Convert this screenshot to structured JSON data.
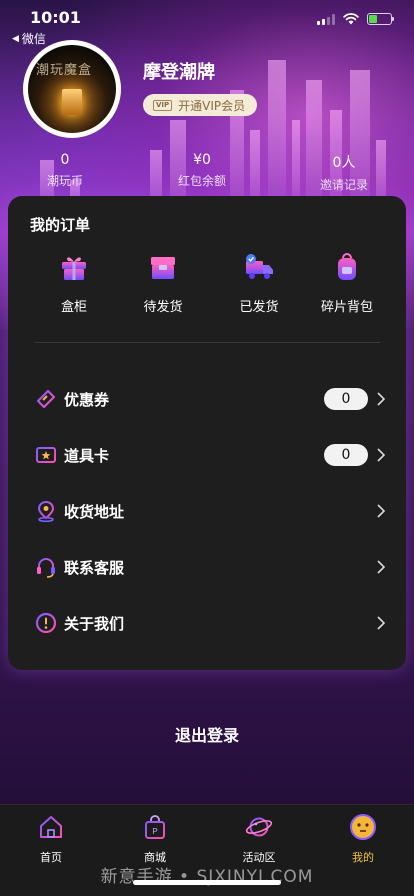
{
  "status_bar": {
    "time": "10:01",
    "back_label": "微信"
  },
  "profile": {
    "avatar_text": "潮玩魔盒",
    "username": "摩登潮牌",
    "vip_badge": "VIP",
    "vip_label": "开通VIP会员"
  },
  "stats": [
    {
      "value": "0",
      "label": "潮玩币"
    },
    {
      "value": "¥0",
      "label": "红包余额"
    },
    {
      "value": "0人",
      "label": "邀请记录"
    }
  ],
  "orders": {
    "title": "我的订单",
    "items": [
      {
        "label": "盒柜",
        "icon": "gift-icon"
      },
      {
        "label": "待发货",
        "icon": "package-icon"
      },
      {
        "label": "已发货",
        "icon": "truck-icon"
      },
      {
        "label": "碎片背包",
        "icon": "backpack-icon"
      }
    ]
  },
  "menu": [
    {
      "label": "优惠券",
      "icon": "coupon-icon",
      "count": "0"
    },
    {
      "label": "道具卡",
      "icon": "prop-card-icon",
      "count": "0"
    },
    {
      "label": "收货地址",
      "icon": "location-icon"
    },
    {
      "label": "联系客服",
      "icon": "headset-icon"
    },
    {
      "label": "关于我们",
      "icon": "info-icon"
    }
  ],
  "logout_label": "退出登录",
  "tabs": [
    {
      "label": "首页",
      "icon": "home-icon"
    },
    {
      "label": "商城",
      "icon": "shop-bag-icon"
    },
    {
      "label": "活动区",
      "icon": "planet-icon"
    },
    {
      "label": "我的",
      "icon": "smiley-icon",
      "active": true
    }
  ],
  "watermark": "新意手游 • SJXINYI.COM",
  "colors": {
    "accent": "#f2c14a",
    "card": "#1e1e1e",
    "icon_gradient_start": "#7b5cff",
    "icon_gradient_end": "#ff4fb0"
  }
}
